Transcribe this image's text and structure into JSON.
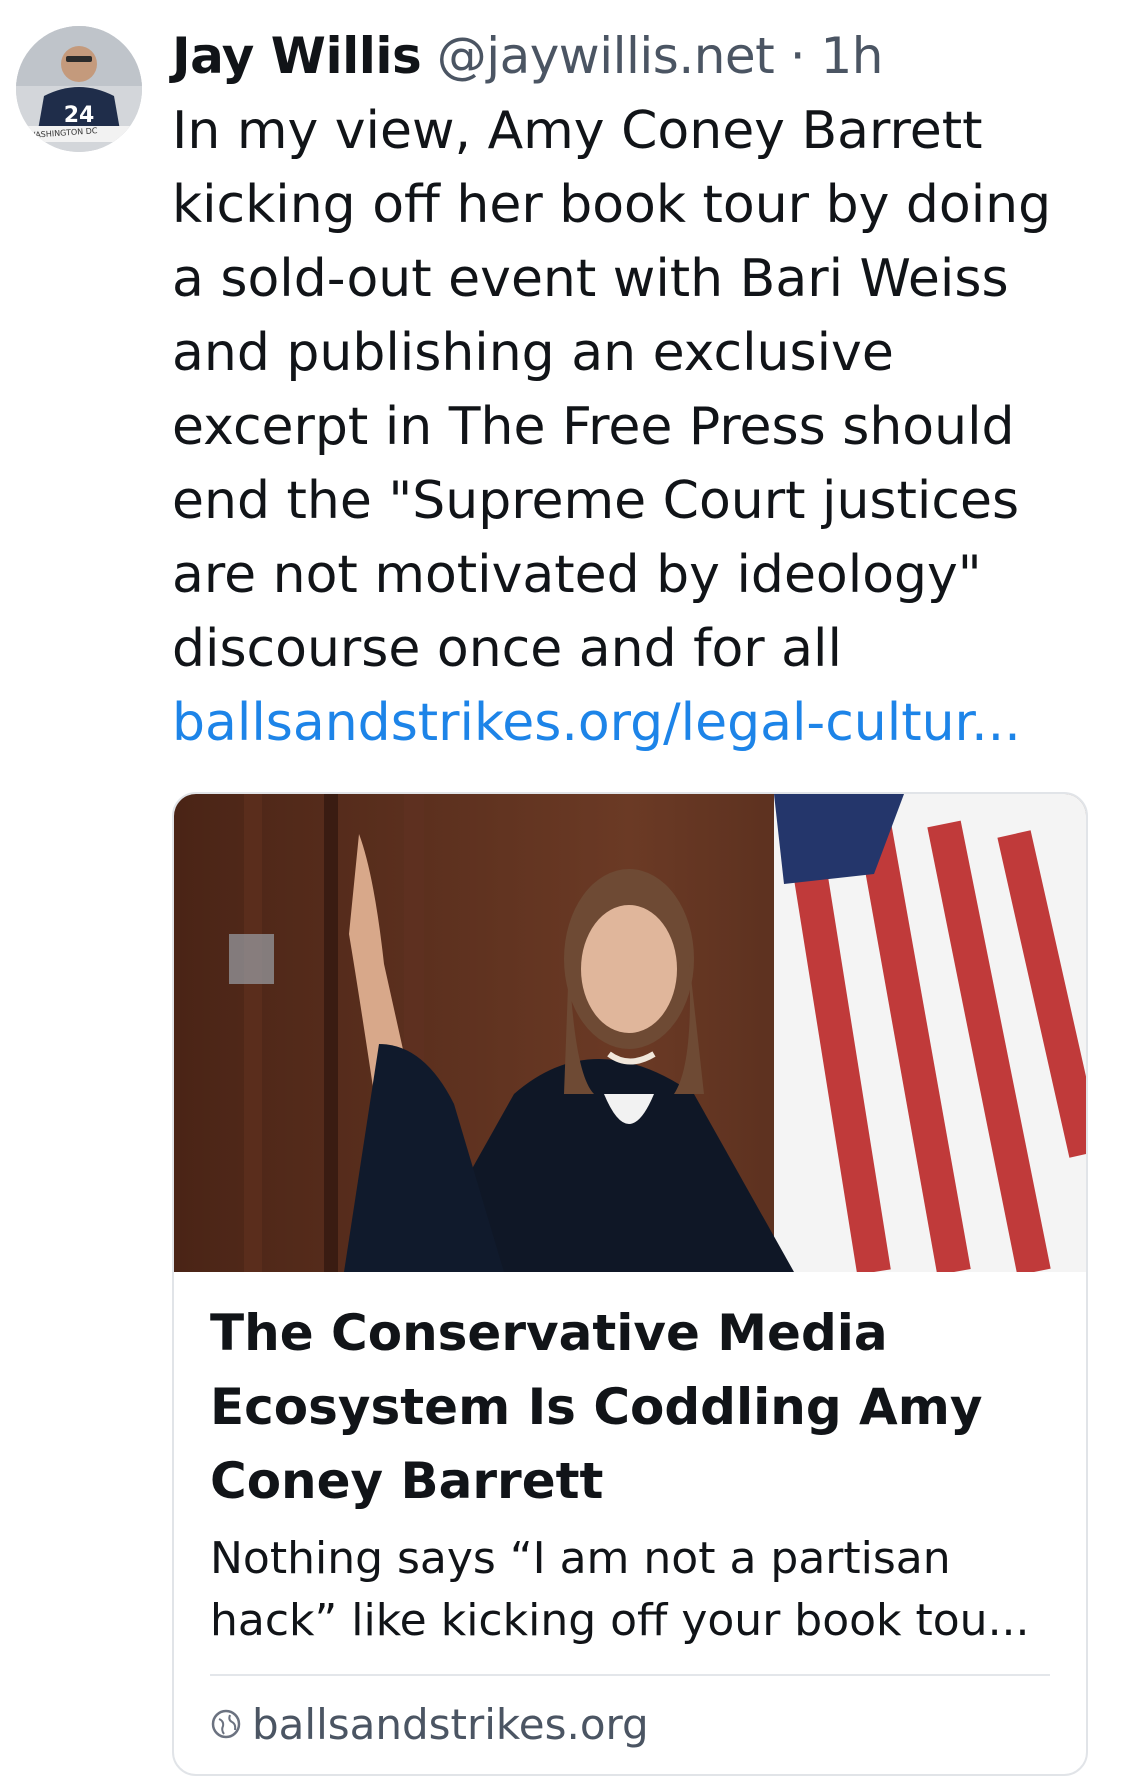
{
  "post": {
    "author": {
      "name": "Jay Willis",
      "handle": "@jaywillis.net",
      "separator": "·",
      "time": "1h",
      "avatar_icon": "avatar-photo",
      "avatar_jersey_number": "24",
      "avatar_banner_text": "WASHINGTON DC"
    },
    "text": "In my view, Amy Coney Barrett\nkicking off her book tour by doing\na sold-out event with Bari Weiss\nand publishing an exclusive\nexcerpt in The Free Press should\nend the \"Supreme Court justices\nare not motivated by ideology\"\ndiscourse once and for all",
    "link_text": "ballsandstrikes.org/legal-cultur...",
    "link_color": "#1d84e8",
    "card": {
      "image_icon": "article-photo",
      "title": "The Conservative Media Ecosystem Is Coddling Amy Coney Barrett",
      "description": "Nothing says “I am not a partisan hack” like kicking off your book tou...",
      "domain": "ballsandstrikes.org",
      "domain_icon": "globe-icon"
    }
  }
}
